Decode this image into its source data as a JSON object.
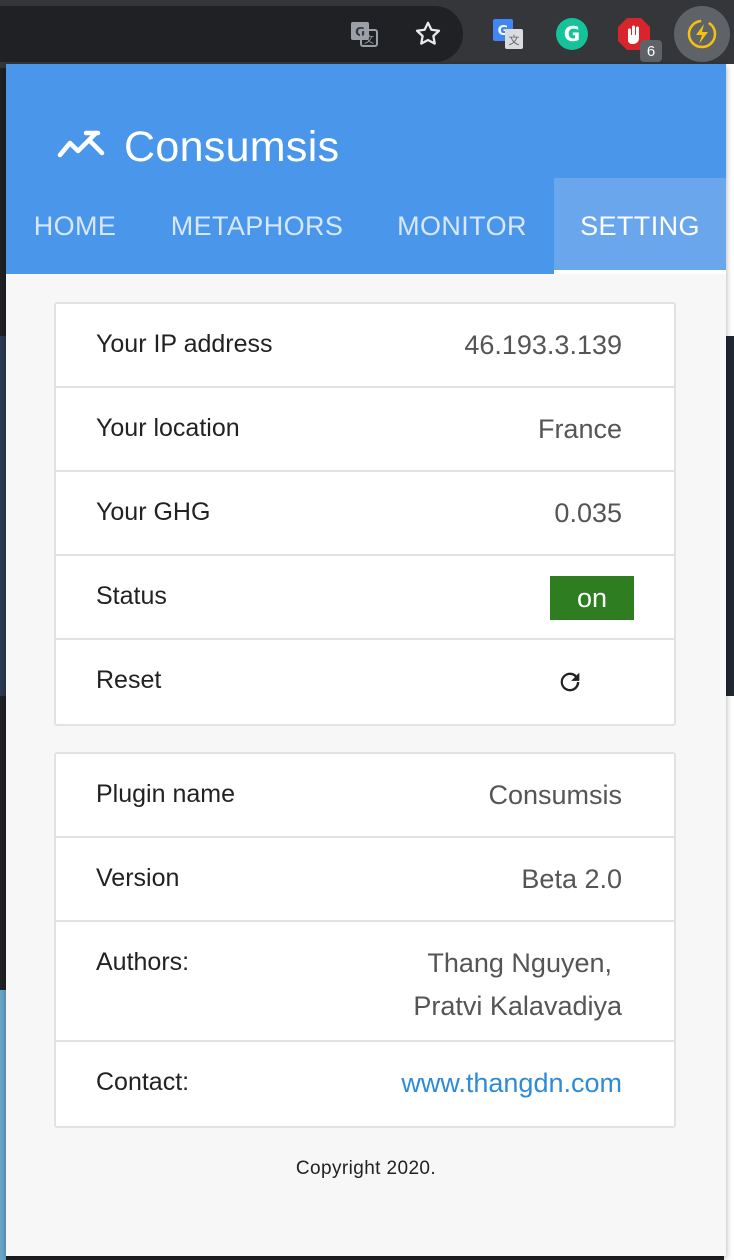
{
  "browser": {
    "extension_badge_count": "6",
    "icons": [
      "translate-icon",
      "bookmark-star-icon",
      "google-translate-extension-icon",
      "grammarly-extension-icon",
      "adblock-extension-icon",
      "consumsis-extension-icon"
    ]
  },
  "app": {
    "title": "Consumsis",
    "brand_color": "#4a96ea",
    "tabs": [
      {
        "label": "HOME"
      },
      {
        "label": "METAPHORS"
      },
      {
        "label": "MONITOR"
      },
      {
        "label": "SETTING"
      }
    ],
    "active_tab": "SETTING"
  },
  "settings": {
    "ip": {
      "label": "Your IP address",
      "value": "46.193.3.139"
    },
    "location": {
      "label": "Your location",
      "value": "France"
    },
    "ghg": {
      "label": "Your GHG",
      "value": "0.035"
    },
    "status": {
      "label": "Status",
      "value": "on",
      "color": "#2e7d20"
    },
    "reset": {
      "label": "Reset",
      "icon": "refresh-icon"
    }
  },
  "about": {
    "plugin": {
      "label": "Plugin name",
      "value": "Consumsis"
    },
    "version": {
      "label": "Version",
      "value": "Beta 2.0"
    },
    "authors": {
      "label": "Authors:",
      "line1": "Thang Nguyen,",
      "line2": "Pratvi Kalavadiya"
    },
    "contact": {
      "label": "Contact:",
      "value": "www.thangdn.com"
    }
  },
  "footer": {
    "copyright": "Copyright 2020."
  }
}
